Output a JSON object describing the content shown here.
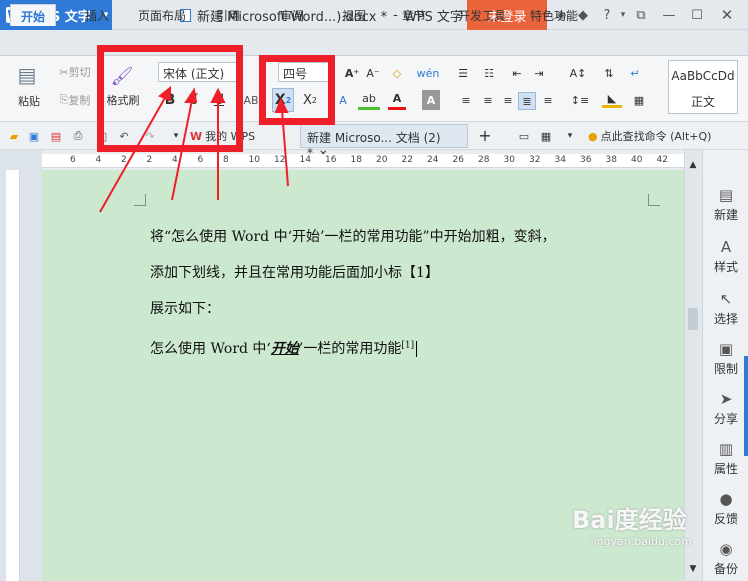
{
  "app": {
    "name": "WPS 文字",
    "dropdown": "▾"
  },
  "title": {
    "doc_name": "新建 Microsoft Word...).docx *",
    "sep": "-",
    "app_name": "WPS 文字"
  },
  "login": "未登录",
  "tabs": [
    "开始",
    "插入",
    "页面布局",
    "引用",
    "审阅",
    "视图",
    "章节",
    "开发工具",
    "特色功能"
  ],
  "ribbon": {
    "paste": "粘贴",
    "cut": "剪切",
    "copy": "复制",
    "format_painter": "格式刷",
    "font_name": "宋体 (正文)",
    "font_size": "四号",
    "bold": "B",
    "italic": "I",
    "underline": "U",
    "superscript": "X",
    "sup_mark": "2",
    "subscript": "X",
    "sub_mark": "2",
    "style_preview": "AaBbCcDd",
    "style_name": "正文"
  },
  "qat": {
    "my_wps": "我的 WPS",
    "doc_tab": "新建 Microso... 文档 (2) *",
    "search": "点此查找命令 (Alt+Q)"
  },
  "ruler_marks": [
    "6",
    "4",
    "2",
    "2",
    "4",
    "6",
    "8",
    "10",
    "12",
    "14",
    "16",
    "18",
    "20",
    "22",
    "24",
    "26",
    "28",
    "30",
    "32",
    "34",
    "36",
    "38",
    "40",
    "42"
  ],
  "document": {
    "line1": "将“怎么使用 Word 中‘开始’一栏的常用功能”中开始加粗，变斜，",
    "line2": "添加下划线，并且在常用功能后面加小标【1】",
    "line3": "展示如下：",
    "line4_pre": "怎么使用 Word 中‘",
    "line4_bold": "开始",
    "line4_post": "’一栏的常用功能",
    "line4_sup": "[1]"
  },
  "side_panel": [
    "新建",
    "样式",
    "选择",
    "限制",
    "分享",
    "属性",
    "反馈",
    "备份"
  ],
  "watermark": {
    "brand": "Bai度经验",
    "url": "jingyan.baidu.com"
  },
  "colors": {
    "accent": "#2f7ad6",
    "login": "#e9633b",
    "highlight": "#ef1f2a",
    "page": "#cce8cf"
  }
}
